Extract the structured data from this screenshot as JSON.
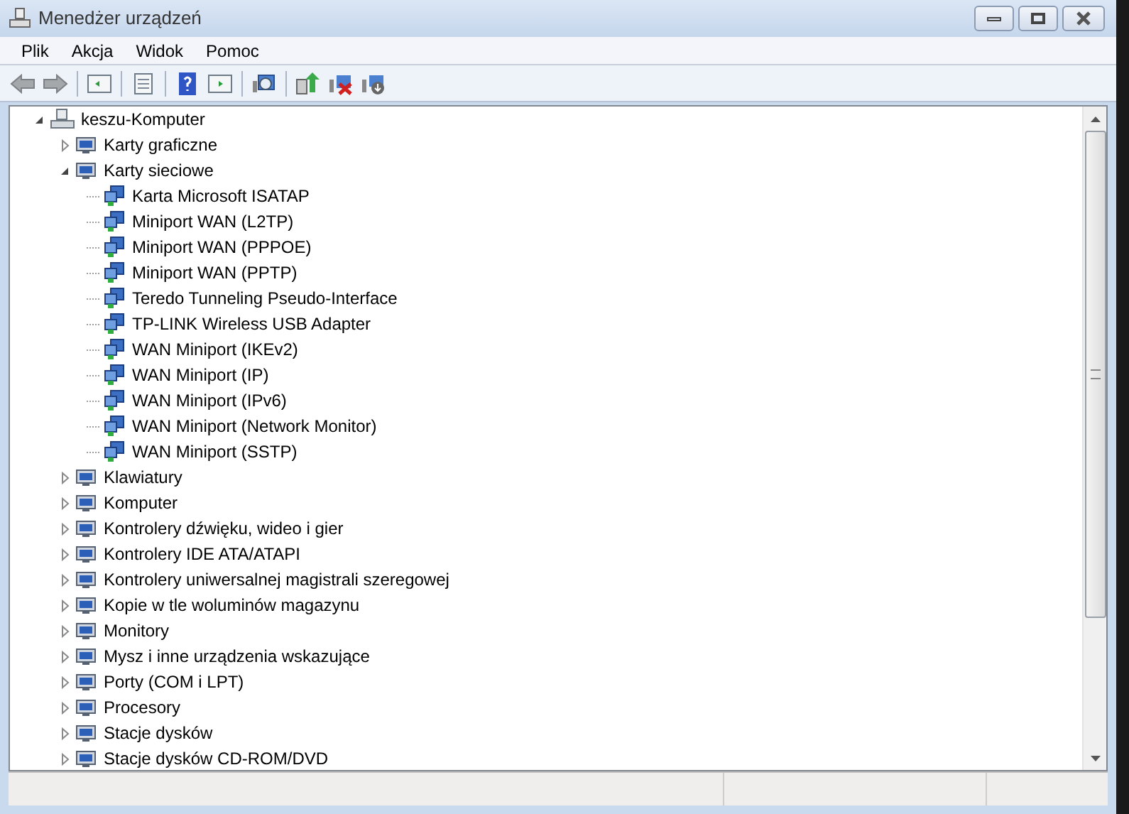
{
  "window": {
    "title": "Menedżer urządzeń"
  },
  "menu": [
    "Plik",
    "Akcja",
    "Widok",
    "Pomoc"
  ],
  "tree": {
    "label": "keszu-Komputer",
    "expanded": true,
    "children": [
      {
        "label": "Karty graficzne",
        "expanded": false
      },
      {
        "label": "Karty sieciowe",
        "expanded": true,
        "children": [
          {
            "label": "Karta Microsoft ISATAP"
          },
          {
            "label": "Miniport WAN (L2TP)"
          },
          {
            "label": "Miniport WAN (PPPOE)"
          },
          {
            "label": "Miniport WAN (PPTP)"
          },
          {
            "label": "Teredo Tunneling Pseudo-Interface"
          },
          {
            "label": "TP-LINK Wireless USB Adapter"
          },
          {
            "label": "WAN Miniport (IKEv2)"
          },
          {
            "label": "WAN Miniport (IP)"
          },
          {
            "label": "WAN Miniport (IPv6)"
          },
          {
            "label": "WAN Miniport (Network Monitor)"
          },
          {
            "label": "WAN Miniport (SSTP)"
          }
        ]
      },
      {
        "label": "Klawiatury",
        "expanded": false
      },
      {
        "label": "Komputer",
        "expanded": false
      },
      {
        "label": "Kontrolery dźwięku, wideo i gier",
        "expanded": false
      },
      {
        "label": "Kontrolery IDE ATA/ATAPI",
        "expanded": false
      },
      {
        "label": "Kontrolery uniwersalnej magistrali szeregowej",
        "expanded": false
      },
      {
        "label": "Kopie w tle woluminów magazynu",
        "expanded": false
      },
      {
        "label": "Monitory",
        "expanded": false
      },
      {
        "label": "Mysz i inne urządzenia wskazujące",
        "expanded": false
      },
      {
        "label": "Porty (COM i LPT)",
        "expanded": false
      },
      {
        "label": "Procesory",
        "expanded": false
      },
      {
        "label": "Stacje dysków",
        "expanded": false
      },
      {
        "label": "Stacje dysków CD-ROM/DVD",
        "expanded": false
      }
    ]
  }
}
